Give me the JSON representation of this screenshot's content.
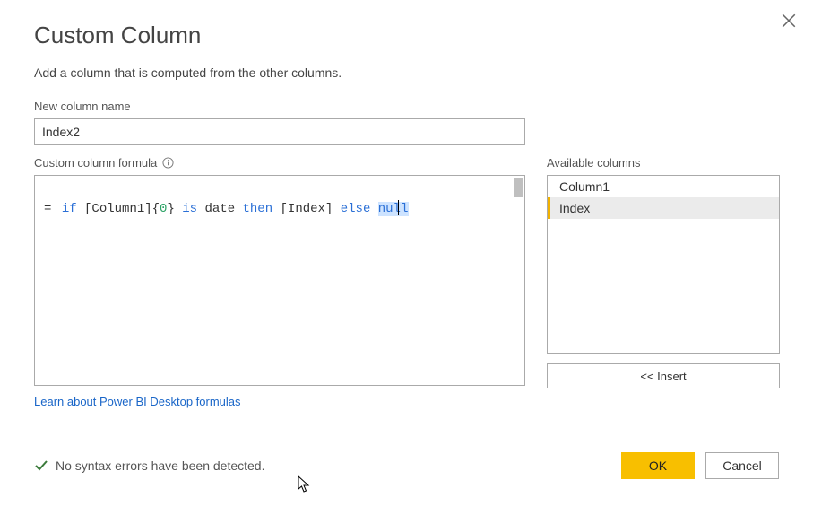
{
  "dialog": {
    "title": "Custom Column",
    "subtitle": "Add a column that is computed from the other columns.",
    "name_label": "New column name",
    "name_value": "Index2",
    "formula_label": "Custom column formula",
    "formula_tokens": {
      "eq": "=",
      "if": "if",
      "col1": "[Column1]{",
      "zero": "0",
      "brace_close": "}",
      "is": "is",
      "date": "date",
      "then": "then",
      "index": "[Index]",
      "else": "else",
      "null_pre": "nul",
      "null_post": "l"
    },
    "learn_link": "Learn about Power BI Desktop formulas",
    "available_label": "Available columns",
    "available_items": [
      "Column1",
      "Index"
    ],
    "selected_item_index": 1,
    "insert_label": "<< Insert",
    "status_text": "No syntax errors have been detected.",
    "ok_label": "OK",
    "cancel_label": "Cancel"
  }
}
